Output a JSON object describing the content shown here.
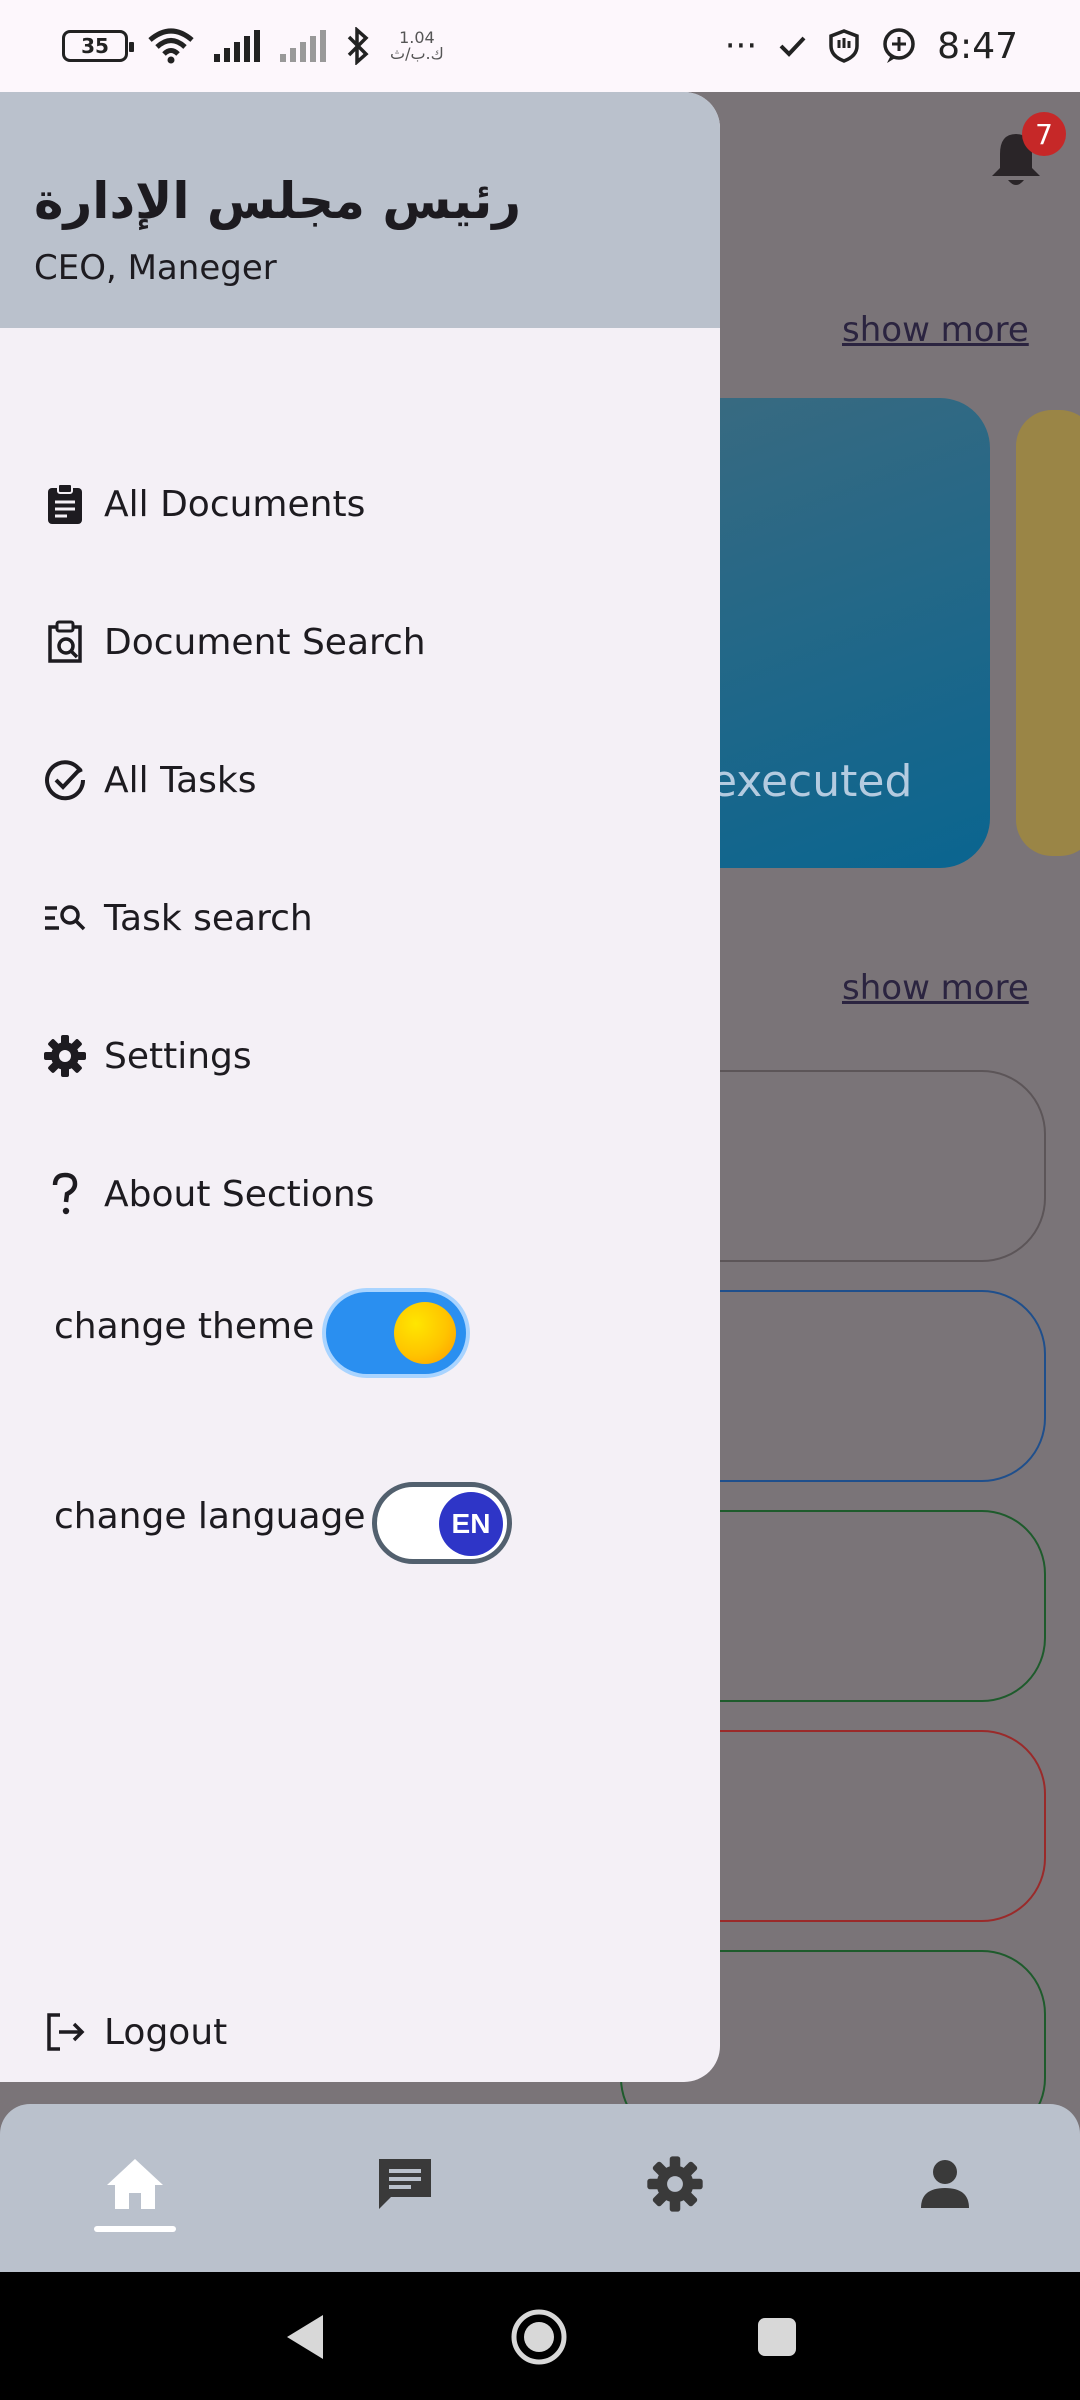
{
  "status_bar": {
    "battery": "35",
    "net_speed": "1.04",
    "net_unit": "ك.ب/ث",
    "more": "···",
    "time": "8:47"
  },
  "background": {
    "notification_count": "7",
    "show_more_1": "show more",
    "show_more_2": "show more",
    "card_text": "executed",
    "pill_colors": [
      "#5c5558",
      "#1f4f8c",
      "#1e5b2c",
      "#9a2a2a",
      "#1e5b2c"
    ]
  },
  "drawer": {
    "header": {
      "name": "رئيس مجلس الإدارة",
      "role": "CEO, Maneger"
    },
    "items": [
      {
        "label": "All Documents",
        "icon": "clipboard-icon"
      },
      {
        "label": "Document Search",
        "icon": "clipboard-search-icon"
      },
      {
        "label": "All Tasks",
        "icon": "check-circle-icon"
      },
      {
        "label": "Task search",
        "icon": "list-search-icon"
      },
      {
        "label": "Settings",
        "icon": "gear-icon"
      },
      {
        "label": "About Sections",
        "icon": "question-icon"
      }
    ],
    "theme_label": "change theme",
    "language_label": "change language",
    "language_value": "EN",
    "logout_label": "Logout"
  },
  "bottom_nav": [
    "home-icon",
    "chat-icon",
    "gear-icon",
    "person-icon"
  ],
  "colors": {
    "drawer_bg": "#f4f0f6",
    "header_bg": "#bac1cc",
    "scrim": "#7a7478",
    "theme_switch": "#2a8ff0",
    "lang_knob": "#2e35c7"
  }
}
